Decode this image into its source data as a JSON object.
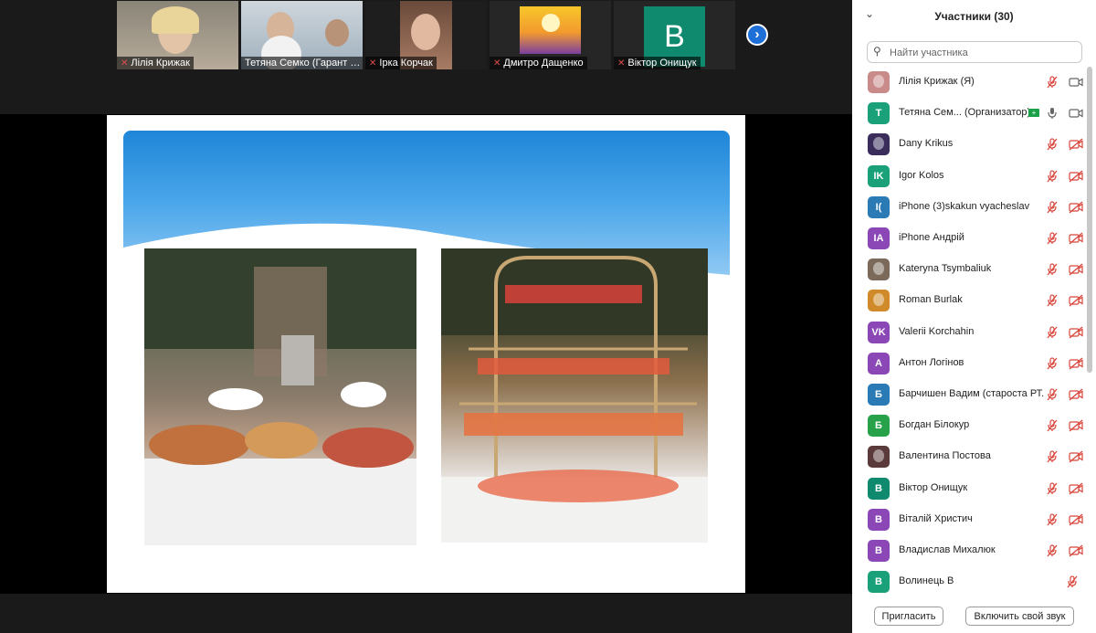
{
  "video_strip": {
    "tiles": [
      {
        "name": "Лілія Крижак",
        "muted": true
      },
      {
        "name": "Тетяна Семко (Гарант ОП ...",
        "muted": false,
        "active": true
      },
      {
        "name": "Ірка Корчак",
        "muted": true
      },
      {
        "name": "Дмитро Дащенко",
        "muted": true
      },
      {
        "name": "Віктор Онищук",
        "muted": true,
        "avatar_letter": "B"
      }
    ],
    "next_icon": "chevron-right-icon"
  },
  "panel": {
    "title": "Участники (30)",
    "search_placeholder": "Найти участника",
    "participants": [
      {
        "name": "Лілія Крижак",
        "role": "(Я)",
        "avatar": "photo",
        "color": "#c98a8a",
        "mic": "muted",
        "cam": "on"
      },
      {
        "name": "Тетяна Сем...",
        "role": "(Организатор)",
        "avatar": "Т",
        "color": "#1aa179",
        "mic": "on",
        "cam": "on",
        "badge": true
      },
      {
        "name": "Dany Krikus",
        "avatar": "photo",
        "color": "#3a2d5c",
        "mic": "muted",
        "cam": "off"
      },
      {
        "name": "Igor Kolos",
        "avatar": "IK",
        "color": "#1aa179",
        "mic": "muted",
        "cam": "off"
      },
      {
        "name": "iPhone (3)skakun vyacheslav",
        "avatar": "I(",
        "color": "#2a7ab5",
        "mic": "muted",
        "cam": "off"
      },
      {
        "name": "iPhone Андрій",
        "avatar": "IA",
        "color": "#8a47b5",
        "mic": "muted",
        "cam": "off"
      },
      {
        "name": "Kateryna Tsymbaliuk",
        "avatar": "photo",
        "color": "#7b6a5a",
        "mic": "muted",
        "cam": "off"
      },
      {
        "name": "Roman Burlak",
        "avatar": "photo",
        "color": "#d08a2a",
        "mic": "muted",
        "cam": "off"
      },
      {
        "name": "Valerii Korchahin",
        "avatar": "VK",
        "color": "#8a47b5",
        "mic": "muted",
        "cam": "off"
      },
      {
        "name": "Антон Логінов",
        "avatar": "A",
        "color": "#8a47b5",
        "mic": "muted",
        "cam": "off"
      },
      {
        "name": "Барчишен Вадим (староста РТ...",
        "avatar": "Б",
        "color": "#2a7ab5",
        "mic": "muted",
        "cam": "off"
      },
      {
        "name": "Богдан Білокур",
        "avatar": "Б",
        "color": "#27a24a",
        "mic": "muted",
        "cam": "off"
      },
      {
        "name": "Валентина Постова",
        "avatar": "photo",
        "color": "#5a3a3a",
        "mic": "muted",
        "cam": "off"
      },
      {
        "name": "Віктор Онищук",
        "avatar": "B",
        "color": "#0f8a6e",
        "mic": "muted",
        "cam": "off"
      },
      {
        "name": "Віталій Христич",
        "avatar": "B",
        "color": "#8a47b5",
        "mic": "muted",
        "cam": "off"
      },
      {
        "name": "Владислав Михалюк",
        "avatar": "B",
        "color": "#8a47b5",
        "mic": "muted",
        "cam": "off"
      },
      {
        "name": "Волинець В",
        "avatar": "B",
        "color": "#1aa179",
        "mic": "muted",
        "cam": "none"
      }
    ],
    "invite_label": "Пригласить",
    "unmute_label": "Включить свой звук"
  }
}
